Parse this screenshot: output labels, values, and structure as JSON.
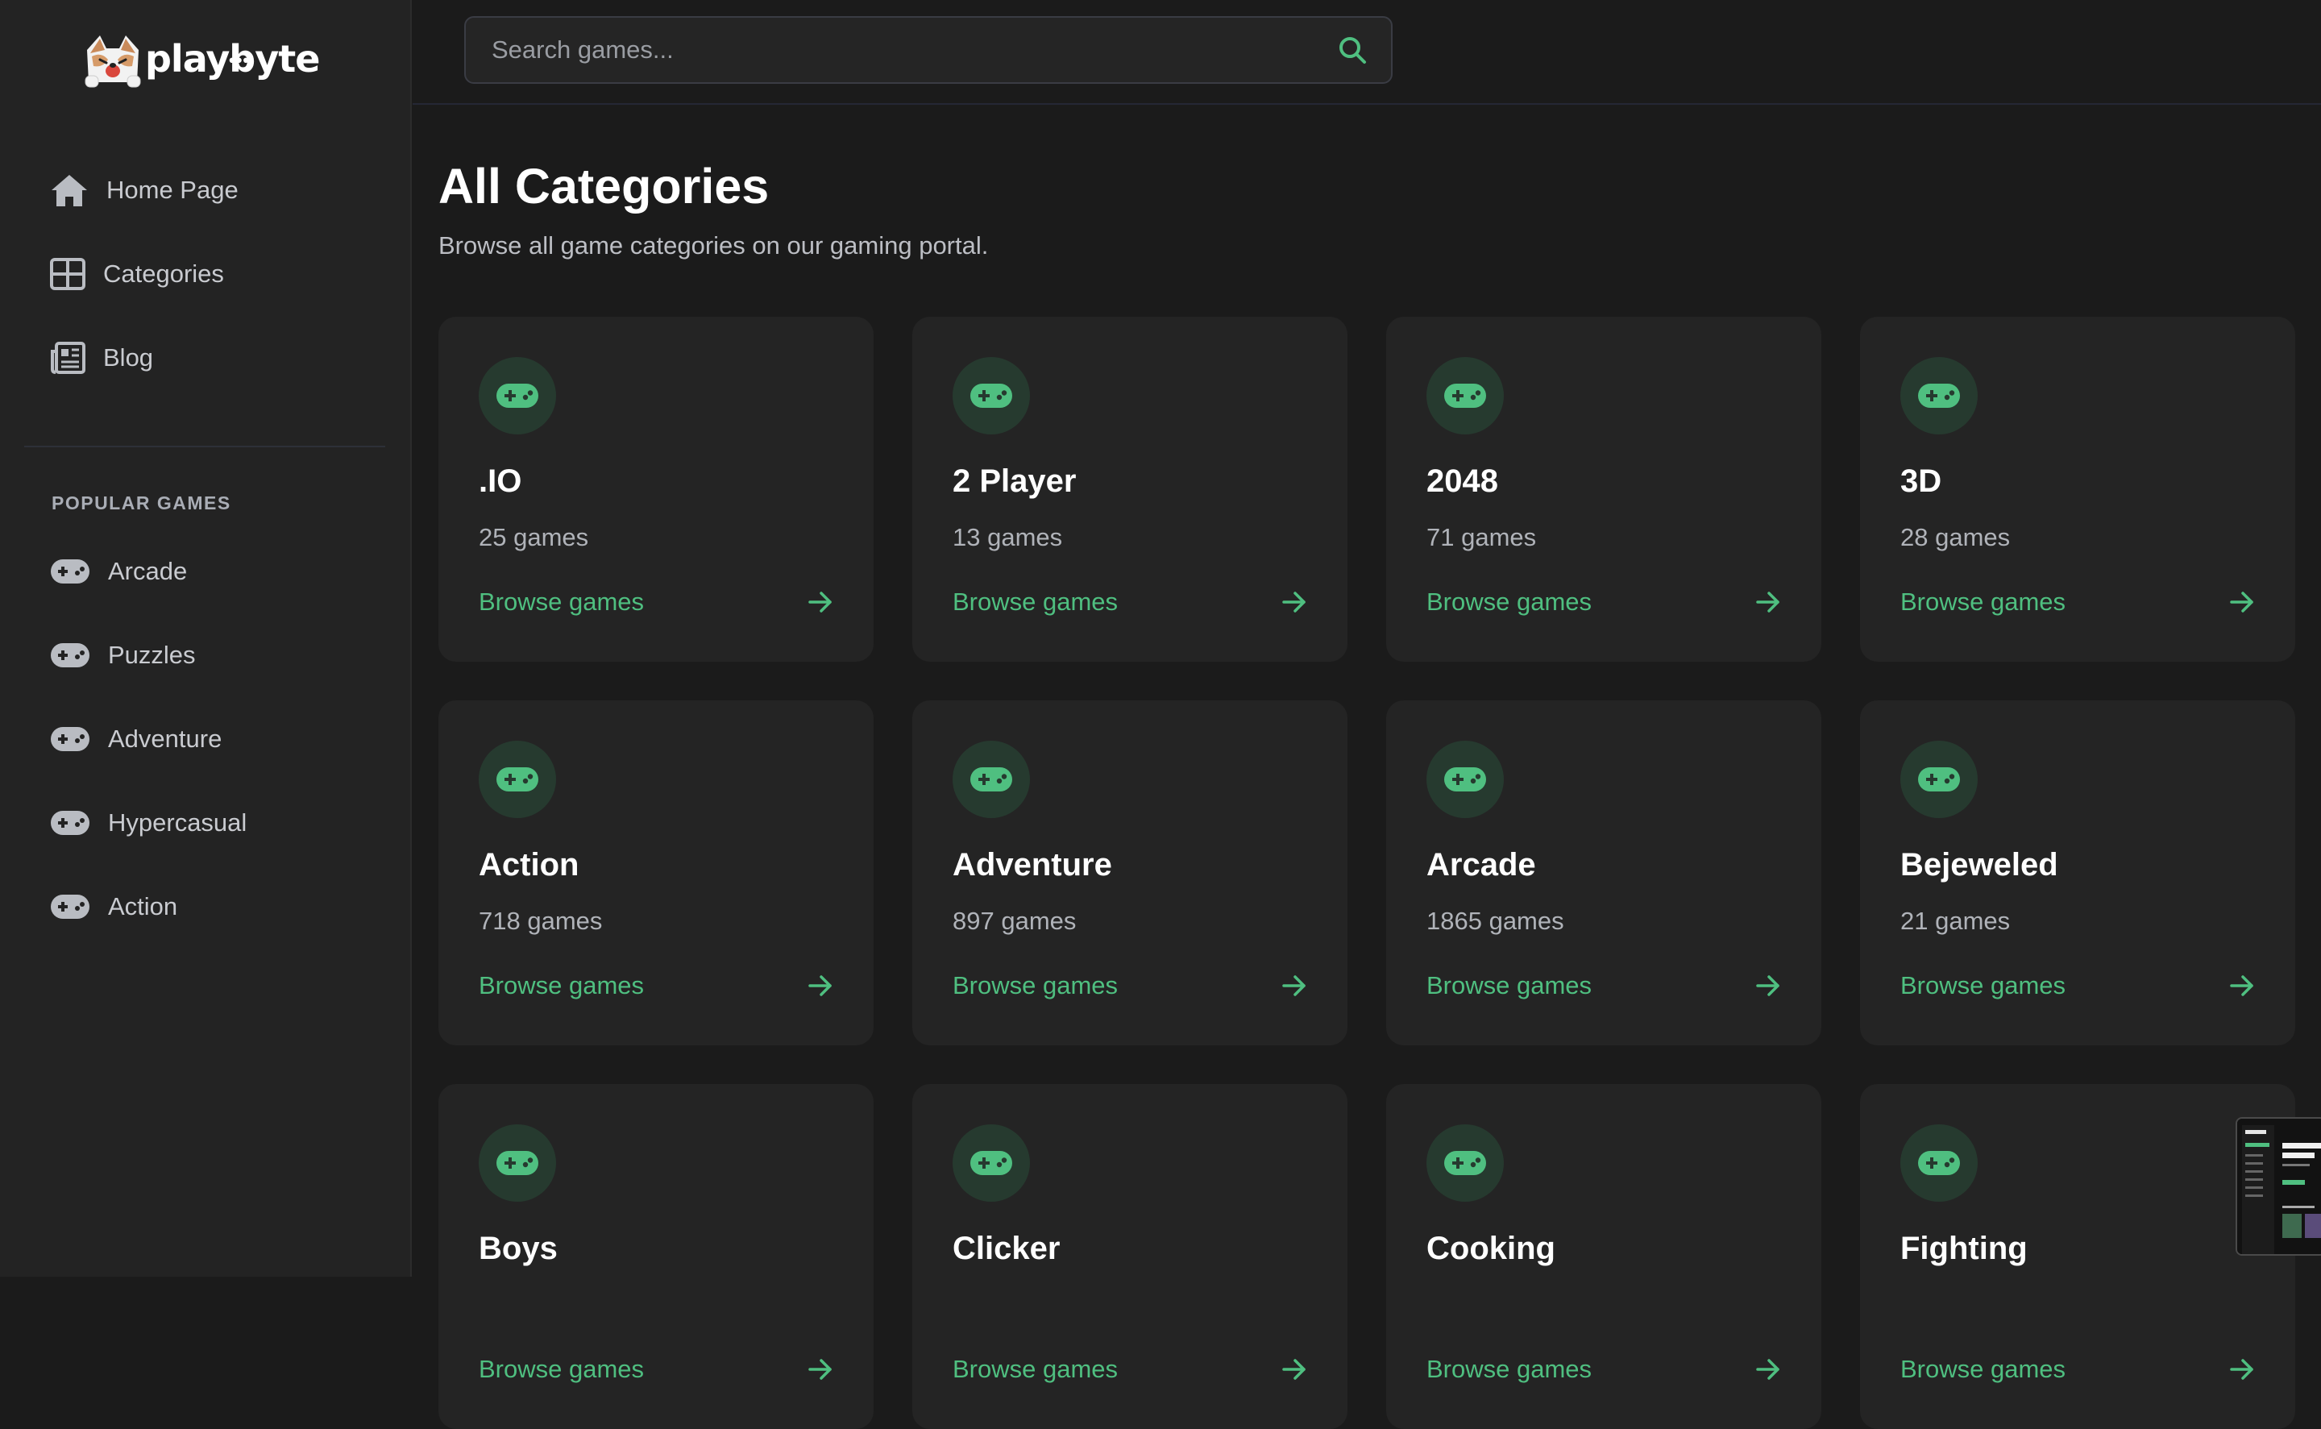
{
  "brand": {
    "name": "playbyte",
    "dots": "•••"
  },
  "sidebar": {
    "nav": [
      {
        "label": "Home Page",
        "icon": "home-icon"
      },
      {
        "label": "Categories",
        "icon": "grid-icon"
      },
      {
        "label": "Blog",
        "icon": "newspaper-icon"
      }
    ],
    "popular_title": "POPULAR GAMES",
    "popular": [
      {
        "label": "Arcade",
        "icon": "gamepad-icon"
      },
      {
        "label": "Puzzles",
        "icon": "gamepad-icon"
      },
      {
        "label": "Adventure",
        "icon": "gamepad-icon"
      },
      {
        "label": "Hypercasual",
        "icon": "gamepad-icon"
      },
      {
        "label": "Action",
        "icon": "gamepad-icon"
      }
    ]
  },
  "search": {
    "placeholder": "Search games...",
    "icon": "search-icon"
  },
  "main": {
    "title": "All Categories",
    "subtitle": "Browse all game categories on our gaming portal.",
    "browse_label": "Browse games",
    "categories": [
      {
        "name": ".IO",
        "count": "25 games"
      },
      {
        "name": "2 Player",
        "count": "13 games"
      },
      {
        "name": "2048",
        "count": "71 games"
      },
      {
        "name": "3D",
        "count": "28 games"
      },
      {
        "name": "Action",
        "count": "718 games"
      },
      {
        "name": "Adventure",
        "count": "897 games"
      },
      {
        "name": "Arcade",
        "count": "1865 games"
      },
      {
        "name": "Bejeweled",
        "count": "21 games"
      },
      {
        "name": "Boys",
        "count": ""
      },
      {
        "name": "Clicker",
        "count": ""
      },
      {
        "name": "Cooking",
        "count": ""
      },
      {
        "name": "Fighting",
        "count": ""
      }
    ]
  },
  "colors": {
    "accent": "#4fbf80",
    "background": "#1b1b1b",
    "sidebar": "#232323",
    "card": "#242424",
    "icon_bg": "#263a2f"
  }
}
